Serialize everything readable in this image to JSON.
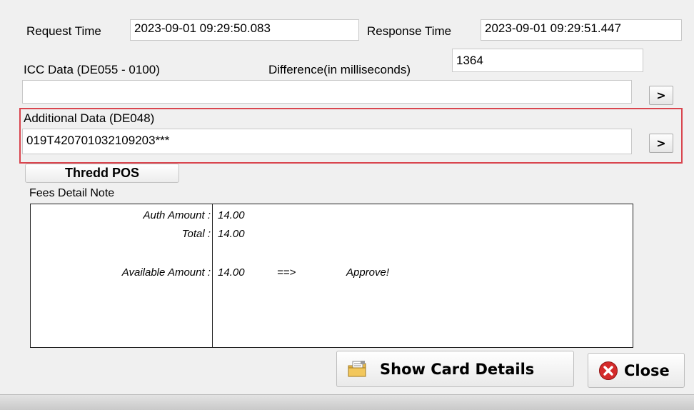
{
  "request": {
    "label": "Request Time",
    "value": "2023-09-01 09:29:50.083"
  },
  "response": {
    "label": "Response Time",
    "value": "2023-09-01 09:29:51.447"
  },
  "icc": {
    "label": "ICC Data (DE055 - 0100)",
    "value": "",
    "expand_label": ">"
  },
  "difference": {
    "label": "Difference(in milliseconds)",
    "value": "1364"
  },
  "additional": {
    "label": "Additional Data (DE048)",
    "value": "019T420701032109203***",
    "expand_label": ">"
  },
  "tab": {
    "label": "Thredd POS"
  },
  "fees": {
    "label": "Fees Detail Note",
    "rows": [
      {
        "label": "Auth Amount :",
        "value": "14.00"
      },
      {
        "label": "Total :",
        "value": "14.00"
      },
      {
        "label": "Available Amount :",
        "value": "14.00",
        "arrow": "==>",
        "result": "Approve!"
      }
    ]
  },
  "buttons": {
    "show_card_details": "Show Card Details",
    "close": "Close"
  },
  "colors": {
    "highlight_border": "#d9454e",
    "close_icon": "#d42a2a"
  }
}
